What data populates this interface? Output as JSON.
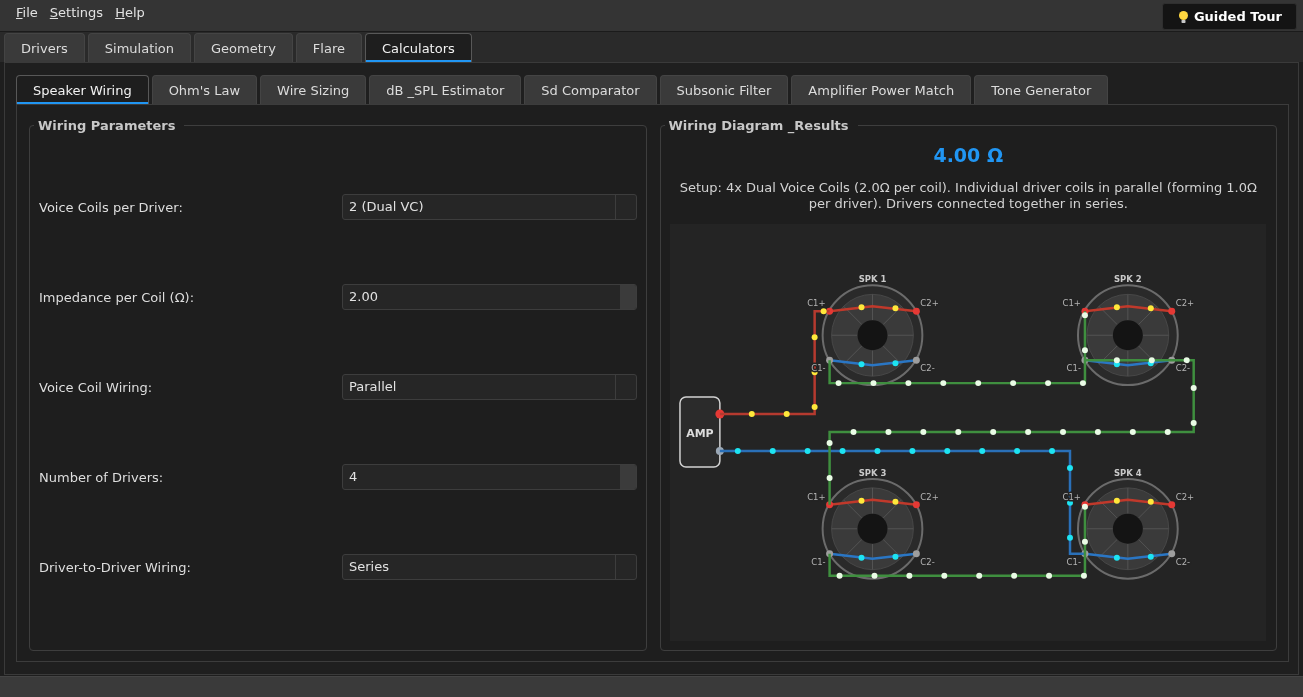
{
  "menu": [
    "File",
    "Settings",
    "Help"
  ],
  "guided_tour_button": "Guided Tour",
  "main_tabs": [
    {
      "label": "Drivers",
      "selected": false
    },
    {
      "label": "Simulation",
      "selected": false
    },
    {
      "label": "Geometry",
      "selected": false
    },
    {
      "label": "Flare",
      "selected": false
    },
    {
      "label": "Calculators",
      "selected": true
    }
  ],
  "calculator_tabs": [
    {
      "label": "Speaker Wiring",
      "selected": true
    },
    {
      "label": "Ohm's Law",
      "selected": false
    },
    {
      "label": "Wire Sizing",
      "selected": false
    },
    {
      "label": "dB _SPL Estimator",
      "selected": false
    },
    {
      "label": "Sd Comparator",
      "selected": false
    },
    {
      "label": "Subsonic Filter",
      "selected": false
    },
    {
      "label": "Amplifier Power Match",
      "selected": false
    },
    {
      "label": "Tone Generator",
      "selected": false
    }
  ],
  "wiring_parameters": {
    "title": "Wiring Parameters",
    "fields": [
      {
        "label": "Voice Coils per Driver:",
        "kind": "combo",
        "value": "2 (Dual VC)"
      },
      {
        "label": "Impedance per Coil (Ω):",
        "kind": "spin",
        "value": "2.00"
      },
      {
        "label": "Voice Coil Wiring:",
        "kind": "combo",
        "value": "Parallel"
      },
      {
        "label": "Number of Drivers:",
        "kind": "spin",
        "value": "4"
      },
      {
        "label": "Driver-to-Driver Wiring:",
        "kind": "combo",
        "value": "Series"
      }
    ]
  },
  "wiring_results": {
    "title": "Wiring Diagram _Results",
    "total_impedance": "4.00 Ω",
    "description": "Setup: 4x Dual Voice Coils (2.0Ω per coil). Individual driver coils in parallel (forming 1.0Ω per driver). Drivers connected together in series.",
    "diagram": {
      "amplifier_label": "AMP",
      "speakers": [
        {
          "label": "SPK 1",
          "terminals": [
            "C1+",
            "C2+",
            "C1-",
            "C2-"
          ]
        },
        {
          "label": "SPK 2",
          "terminals": [
            "C1+",
            "C2+",
            "C1-",
            "C2-"
          ]
        },
        {
          "label": "SPK 3",
          "terminals": [
            "C1+",
            "C2+",
            "C1-",
            "C2-"
          ]
        },
        {
          "label": "SPK 4",
          "terminals": [
            "C1+",
            "C2+",
            "C1-",
            "C2-"
          ]
        }
      ]
    }
  }
}
